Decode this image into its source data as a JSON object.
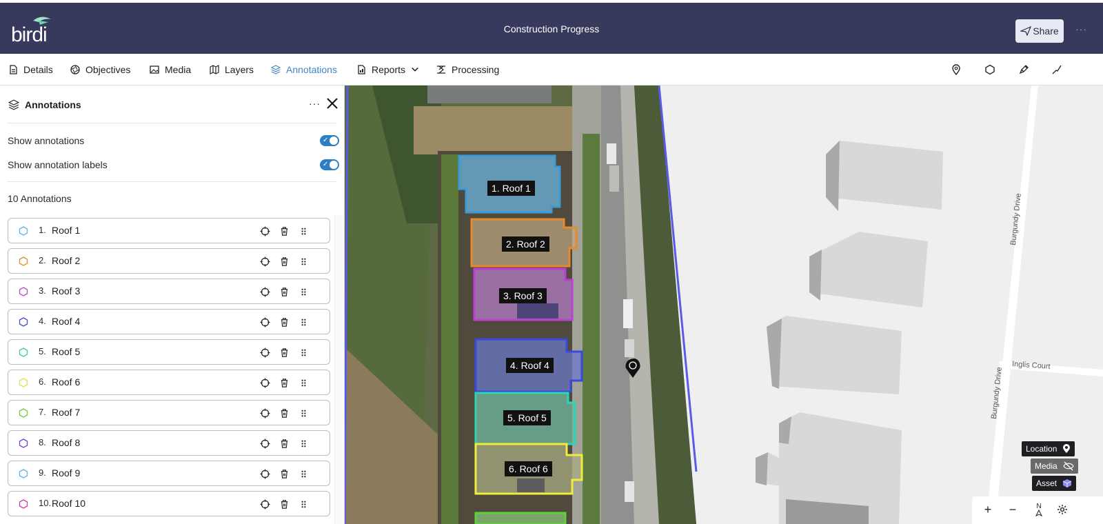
{
  "header": {
    "logo": "birdi",
    "title": "Construction Progress",
    "share_label": "Share",
    "more": "···"
  },
  "tabs": [
    {
      "label": "Details",
      "icon": "document-icon"
    },
    {
      "label": "Objectives",
      "icon": "aperture-icon"
    },
    {
      "label": "Media",
      "icon": "image-icon"
    },
    {
      "label": "Layers",
      "icon": "map-icon"
    },
    {
      "label": "Annotations",
      "icon": "layers-icon",
      "active": true
    },
    {
      "label": "Reports",
      "icon": "report-icon"
    },
    {
      "label": "Processing",
      "icon": "processing-icon"
    }
  ],
  "toolbar_icons": [
    "location-pin-icon",
    "polygon-icon",
    "pen-icon",
    "line-icon"
  ],
  "sidebar": {
    "title": "Annotations",
    "more": "···",
    "show_annotations": "Show annotations",
    "show_labels": "Show annotation labels",
    "count_label": "10 Annotations",
    "items": [
      {
        "num": "1.",
        "name": "Roof 1",
        "color": "#5ab8e0"
      },
      {
        "num": "2.",
        "name": "Roof 2",
        "color": "#d7902e"
      },
      {
        "num": "3.",
        "name": "Roof 3",
        "color": "#b94ac9"
      },
      {
        "num": "4.",
        "name": "Roof 4",
        "color": "#3b4fc6"
      },
      {
        "num": "5.",
        "name": "Roof 5",
        "color": "#38c9b0"
      },
      {
        "num": "6.",
        "name": "Roof 6",
        "color": "#e2e24a"
      },
      {
        "num": "7.",
        "name": "Roof 7",
        "color": "#6ccf3b"
      },
      {
        "num": "8.",
        "name": "Roof 8",
        "color": "#7a3bd6"
      },
      {
        "num": "9.",
        "name": "Roof 9",
        "color": "#5ab8e0"
      },
      {
        "num": "10.",
        "name": "Roof 10",
        "color": "#c93ba8"
      }
    ]
  },
  "map": {
    "roof_labels": [
      "1. Roof 1",
      "2. Roof 2",
      "3. Roof 3",
      "4. Roof 4",
      "5. Roof 5",
      "6. Roof 6"
    ],
    "streets": {
      "burgundy_1": "Burgundy Drive",
      "burgundy_2": "Burgundy Drive",
      "inglis": "Inglis Court"
    },
    "legend": {
      "location": "Location",
      "media": "Media",
      "asset": "Asset"
    },
    "zoom_in": "+",
    "zoom_out": "−",
    "compass": "N"
  }
}
